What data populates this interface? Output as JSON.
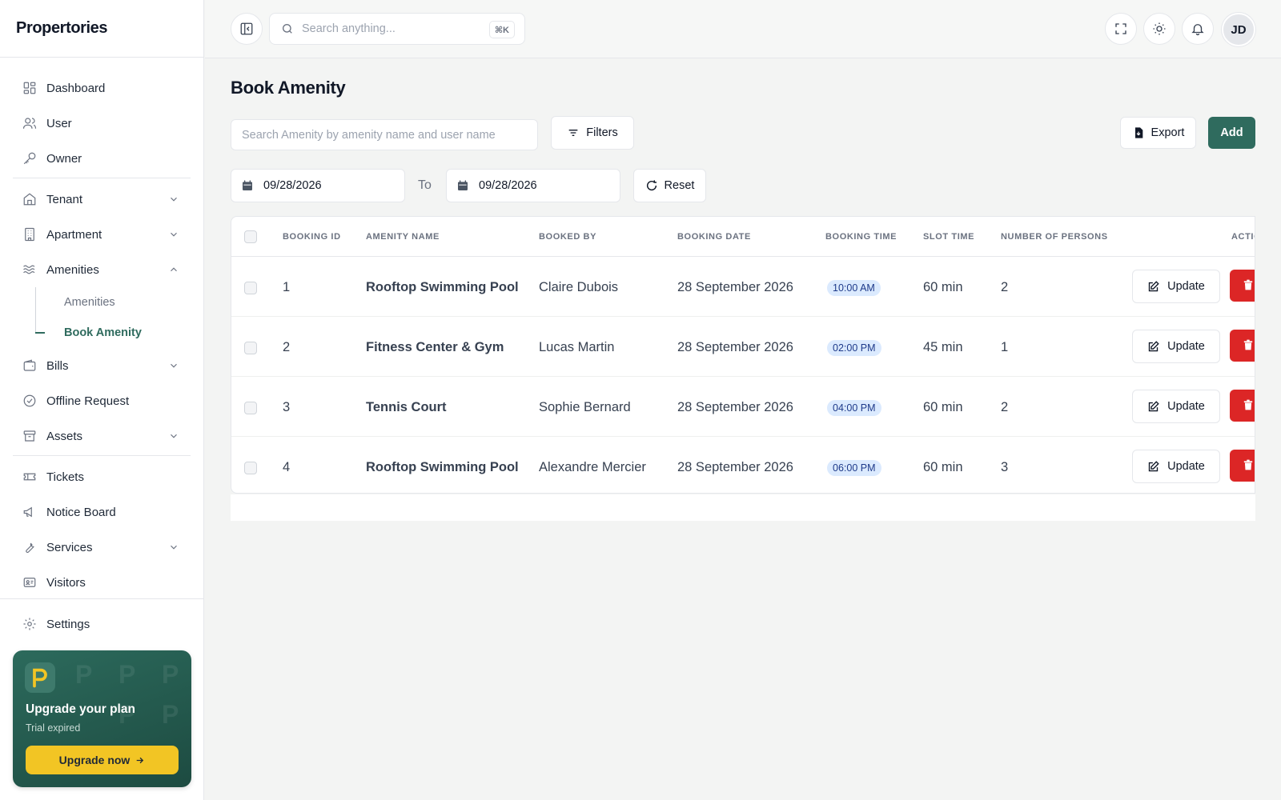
{
  "brand": "Propertories",
  "sidebar": {
    "items": [
      {
        "label": "Dashboard",
        "icon": "dashboard-icon"
      },
      {
        "label": "User",
        "icon": "users-icon"
      },
      {
        "label": "Owner",
        "icon": "key-icon"
      },
      {
        "label": "Tenant",
        "icon": "home-icon"
      },
      {
        "label": "Apartment",
        "icon": "building-icon"
      },
      {
        "label": "Amenities",
        "icon": "waves-icon"
      },
      {
        "label": "Bills",
        "icon": "wallet-icon"
      },
      {
        "label": "Offline Request",
        "icon": "check-circle-icon"
      },
      {
        "label": "Assets",
        "icon": "archive-icon"
      },
      {
        "label": "Tickets",
        "icon": "ticket-icon"
      },
      {
        "label": "Notice Board",
        "icon": "megaphone-icon"
      },
      {
        "label": "Services",
        "icon": "wrench-icon"
      },
      {
        "label": "Visitors",
        "icon": "id-card-icon"
      }
    ],
    "amenities_sub": [
      {
        "label": "Amenities"
      },
      {
        "label": "Book Amenity"
      }
    ],
    "settings_label": "Settings"
  },
  "upgrade": {
    "title": "Upgrade your plan",
    "subtitle": "Trial expired",
    "button": "Upgrade now"
  },
  "topbar": {
    "search_placeholder": "Search anything...",
    "shortcut": "⌘K",
    "avatar_initials": "JD"
  },
  "page": {
    "title": "Book Amenity",
    "search_placeholder": "Search Amenity by amenity name and user name",
    "filters_label": "Filters",
    "export_label": "Export",
    "add_label": "Add",
    "date_from": "09/28/2026",
    "date_to": "09/28/2026",
    "to_label": "To",
    "reset_label": "Reset"
  },
  "table": {
    "headers": [
      "BOOKING ID",
      "AMENITY NAME",
      "BOOKED BY",
      "BOOKING DATE",
      "BOOKING TIME",
      "SLOT TIME",
      "NUMBER OF PERSONS",
      "ACTIO"
    ],
    "update_label": "Update",
    "rows": [
      {
        "id": "1",
        "amenity": "Rooftop Swimming Pool",
        "booked_by": "Claire Dubois",
        "date": "28 September 2026",
        "time": "10:00 AM",
        "slot": "60 min",
        "persons": "2"
      },
      {
        "id": "2",
        "amenity": "Fitness Center & Gym",
        "booked_by": "Lucas Martin",
        "date": "28 September 2026",
        "time": "02:00 PM",
        "slot": "45 min",
        "persons": "1"
      },
      {
        "id": "3",
        "amenity": "Tennis Court",
        "booked_by": "Sophie Bernard",
        "date": "28 September 2026",
        "time": "04:00 PM",
        "slot": "60 min",
        "persons": "2"
      },
      {
        "id": "4",
        "amenity": "Rooftop Swimming Pool",
        "booked_by": "Alexandre Mercier",
        "date": "28 September 2026",
        "time": "06:00 PM",
        "slot": "60 min",
        "persons": "3"
      }
    ]
  },
  "colors": {
    "primary": "#2f6b5e",
    "danger": "#dc2626",
    "accent_yellow": "#f2c524",
    "badge_bg": "#dbeafe"
  }
}
